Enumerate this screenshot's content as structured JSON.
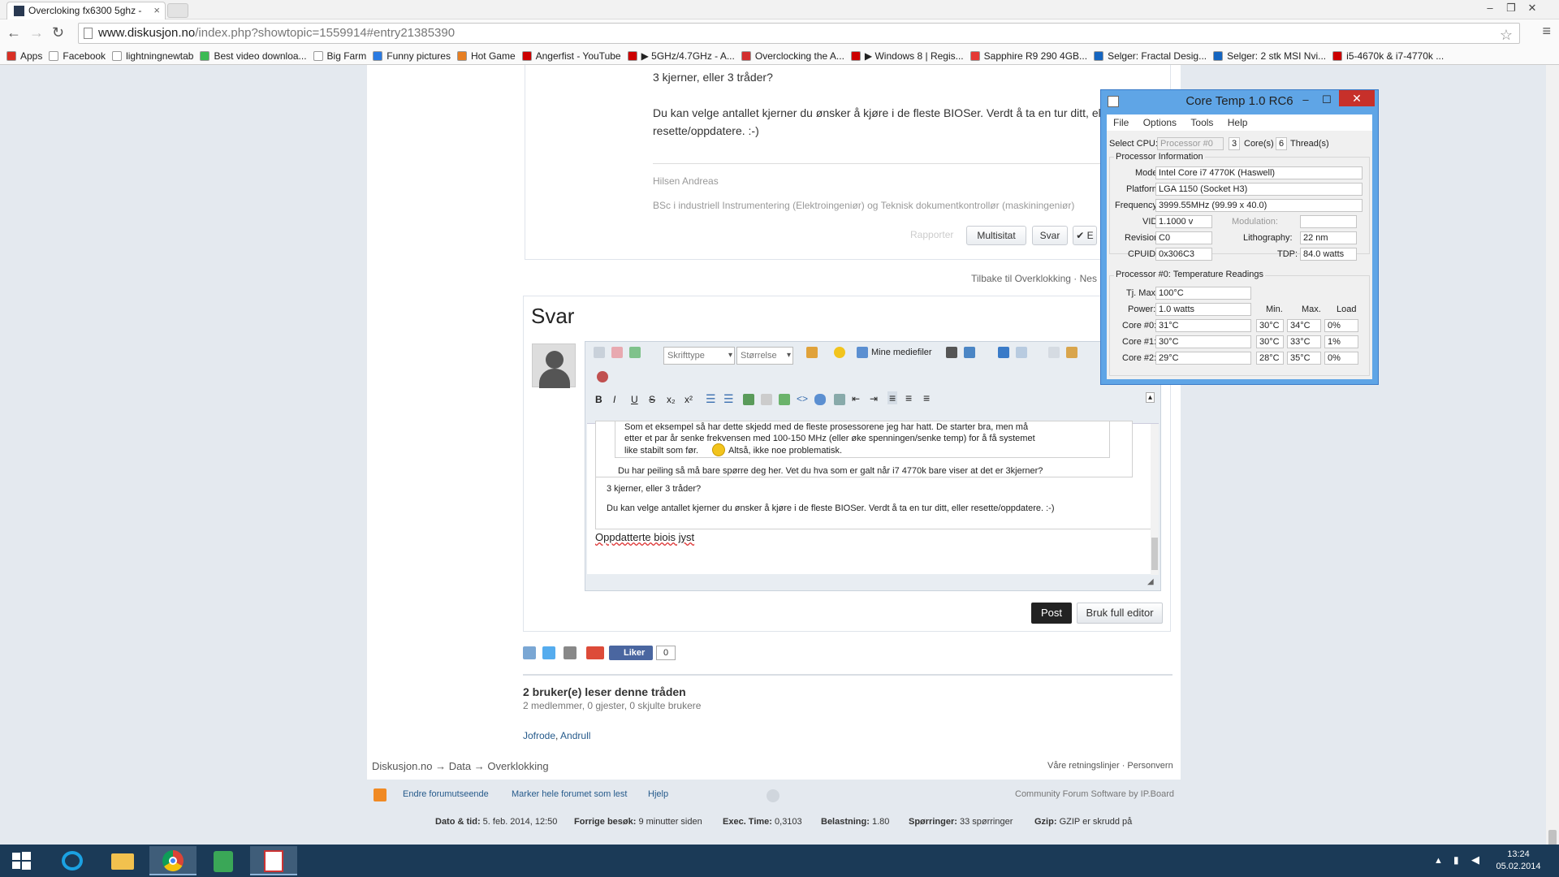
{
  "browser": {
    "tab_title": "Overcloking fx6300 5ghz -",
    "tab_close": "×",
    "window_controls": [
      "–",
      "❐",
      "✕"
    ],
    "url_host": "www.diskusjon.no",
    "url_path": "/index.php?showtopic=1559914#entry21385390",
    "bookmarks": [
      {
        "label": "Apps",
        "color": "#d93025"
      },
      {
        "label": "Facebook",
        "color": "#ffffff"
      },
      {
        "label": "lightningnewtab",
        "color": "#ffffff"
      },
      {
        "label": "Best video downloa...",
        "color": "#3cba54"
      },
      {
        "label": "Big Farm",
        "color": "#ffffff"
      },
      {
        "label": "Funny pictures",
        "color": "#2a7ae2"
      },
      {
        "label": "Hot Game",
        "color": "#e67e22"
      },
      {
        "label": "Angerfist - YouTube",
        "color": "#cc0000"
      },
      {
        "label": "▶ 5GHz/4.7GHz - A...",
        "color": "#cc0000"
      },
      {
        "label": "Overclocking the A...",
        "color": "#d32f2f"
      },
      {
        "label": "▶ Windows 8 | Regis...",
        "color": "#cc0000"
      },
      {
        "label": "Sapphire R9 290 4GB...",
        "color": "#e53935"
      },
      {
        "label": "Selger: Fractal Desig...",
        "color": "#1565c0"
      },
      {
        "label": "Selger: 2 stk MSI Nvi...",
        "color": "#1565c0"
      },
      {
        "label": "i5-4670k & i7-4770k ...",
        "color": "#cc0000"
      }
    ]
  },
  "post": {
    "line1": "3 kjerner, eller 3 tråder?",
    "line2": "Du kan velge antallet kjerner du ønsker å kjøre i de fleste BIOSer. Verdt å ta en tur ditt, eller",
    "line3": "resette/oppdatere. :-)",
    "sig_name": "Hilsen Andreas",
    "sig_title": "BSc i industriell Instrumentering (Elektroingeniør) og Teknisk dokumentkontrollør (maskiningeniør)",
    "report": "Rapporter",
    "multiquote": "Multisitat",
    "reply": "Svar",
    "edit_prefix": "✔ E",
    "back_link": "Tilbake til Overklokking",
    "next_link": "· Nes"
  },
  "reply": {
    "title": "Svar",
    "font_select": "Skrifttype",
    "size_select": "Størrelse",
    "media": "Mine mediefiler",
    "quote_line1": "Som et eksempel så har dette skjedd med de fleste prosessorene jeg har hatt. De starter bra, men må",
    "quote_line2": "etter et par år senke frekvensen med 100-150 MHz (eller øke spenningen/senke temp) for å få systemet",
    "quote_line3": "like stabilt som før.",
    "quote_line3b": "Altså, ikke noe problematisk.",
    "quote_line4": "Du har peiling så må bare spørre deg her. Vet du hva som er galt når i7 4770k  bare viser at det er 3kjerner?",
    "inner_q1": "3 kjerner, eller 3 tråder?",
    "inner_q2": "Du kan velge antallet kjerner du ønsker å kjøre i de fleste BIOSer. Verdt å ta en tur ditt, eller resette/oppdatere. :-)",
    "typed": "Oppdatterte biois jyst",
    "post_btn": "Post",
    "full_editor_btn": "Bruk full editor"
  },
  "social": {
    "like": "Liker",
    "like_count": "0"
  },
  "readers": {
    "title": "2 bruker(e) leser denne tråden",
    "detail": "2 medlemmer, 0 gjester, 0 skjulte brukere",
    "user1": "Jofrode",
    "sep": ",",
    "user2": "Andrull"
  },
  "breadcrumb": {
    "b1": "Diskusjon.no",
    "arrow": "→",
    "b2": "Data",
    "b3": "Overklokking",
    "right": "Våre retningslinjer · Personvern"
  },
  "footer": {
    "change_look": "Endre forumutseende",
    "mark_read": "Marker hele forumet som lest",
    "help": "Hjelp",
    "credit": "Community Forum Software by IP.Board",
    "date_label": "Dato & tid:",
    "date_val": "5. feb. 2014, 12:50",
    "prev_label": "Forrige besøk:",
    "prev_val": "9 minutter siden",
    "exec_label": "Exec. Time:",
    "exec_val": "0,3103",
    "load_label": "Belastning:",
    "load_val": "1.80",
    "queries_label": "Spørringer:",
    "queries_val": "33 spørringer",
    "gzip_label": "Gzip:",
    "gzip_val": "GZIP er skrudd på"
  },
  "coretemp": {
    "title": "Core Temp 1.0 RC6",
    "min": "–",
    "max": "☐",
    "close": "✕",
    "menu": [
      "File",
      "Options",
      "Tools",
      "Help"
    ],
    "select_cpu_label": "Select CPU:",
    "processor": "Processor #0",
    "cores": "3",
    "cores_label": "Core(s)",
    "threads": "6",
    "threads_label": "Thread(s)",
    "info_header": "Processor Information",
    "model_label": "Model:",
    "model": "Intel Core i7 4770K (Haswell)",
    "platform_label": "Platform:",
    "platform": "LGA 1150 (Socket H3)",
    "freq_label": "Frequency:",
    "freq": "3999.55MHz (99.99 x 40.0)",
    "vid_label": "VID:",
    "vid": "1.1000 v",
    "mod_label": "Modulation:",
    "rev_label": "Revision:",
    "rev": "C0",
    "litho_label": "Lithography:",
    "litho": "22 nm",
    "cpuid_label": "CPUID:",
    "cpuid": "0x306C3",
    "tdp_label": "TDP:",
    "tdp": "84.0 watts",
    "temp_header": "Processor #0: Temperature Readings",
    "tjmax_label": "Tj. Max:",
    "tjmax": "100°C",
    "power_label": "Power:",
    "power": "1.0 watts",
    "col_min": "Min.",
    "col_max": "Max.",
    "col_load": "Load",
    "cores_rows": [
      {
        "label": "Core #0:",
        "temp": "31°C",
        "min": "30°C",
        "max": "34°C",
        "load": "0%"
      },
      {
        "label": "Core #1:",
        "temp": "30°C",
        "min": "30°C",
        "max": "33°C",
        "load": "1%"
      },
      {
        "label": "Core #2:",
        "temp": "29°C",
        "min": "28°C",
        "max": "35°C",
        "load": "0%"
      }
    ]
  },
  "taskbar": {
    "time": "13:24",
    "date": "05.02.2014"
  }
}
